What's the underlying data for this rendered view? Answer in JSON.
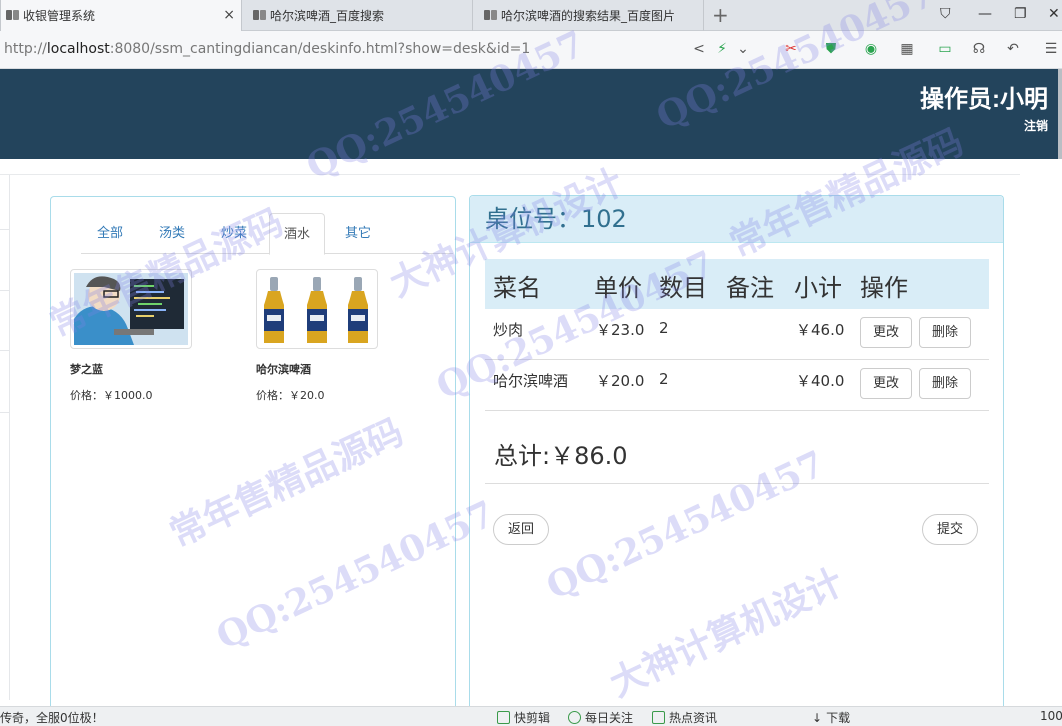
{
  "browser": {
    "tabs": [
      {
        "title": "收银管理系统",
        "close": "×"
      },
      {
        "title": "哈尔滨啤酒_百度搜索"
      },
      {
        "title": "哈尔滨啤酒的搜索结果_百度图片"
      }
    ],
    "new_tab": "+",
    "window_controls": {
      "shirt": "⛉",
      "minimize": "—",
      "maximize": "❐",
      "close": "✕"
    },
    "url": {
      "host": "localhost",
      "rest": ":8080/ssm_cantingdiancan/deskinfo.html?show=desk&id=1",
      "scheme": "http://"
    }
  },
  "header": {
    "operator": "操作员:小明",
    "logout": "注销",
    "color": "#23445c"
  },
  "menu": {
    "categories": [
      "全部",
      "汤类",
      "炒菜",
      "酒水",
      "其它"
    ],
    "active_category": "酒水",
    "dishes": [
      {
        "name": "梦之蓝",
        "price": "价格：￥1000.0",
        "image": "cartoon-coder"
      },
      {
        "name": "哈尔滨啤酒",
        "price": "价格：￥20.0",
        "image": "beer-bottles"
      }
    ]
  },
  "order": {
    "desk": "桌位号：102",
    "columns": [
      "菜名",
      "单价",
      "数目",
      "备注",
      "小计",
      "操作"
    ],
    "rows": [
      {
        "name": "炒肉",
        "price": "￥23.0",
        "qty": "2",
        "note": "",
        "subtotal": "￥46.0",
        "edit": "更改",
        "delete": "删除"
      },
      {
        "name": "哈尔滨啤酒",
        "price": "￥20.0",
        "qty": "2",
        "note": "",
        "subtotal": "￥40.0",
        "edit": "更改",
        "delete": "删除"
      }
    ],
    "total": "总计:￥86.0",
    "back": "返回",
    "submit": "提交"
  },
  "statusbar": {
    "left": "传奇，全服0位极！",
    "items": [
      "快剪辑",
      "每日关注",
      "热点资讯",
      "下载"
    ],
    "zoom": "100"
  },
  "watermark_texts": [
    "QQ:254540457",
    "常年售精品源码",
    "大神计算机设计"
  ]
}
